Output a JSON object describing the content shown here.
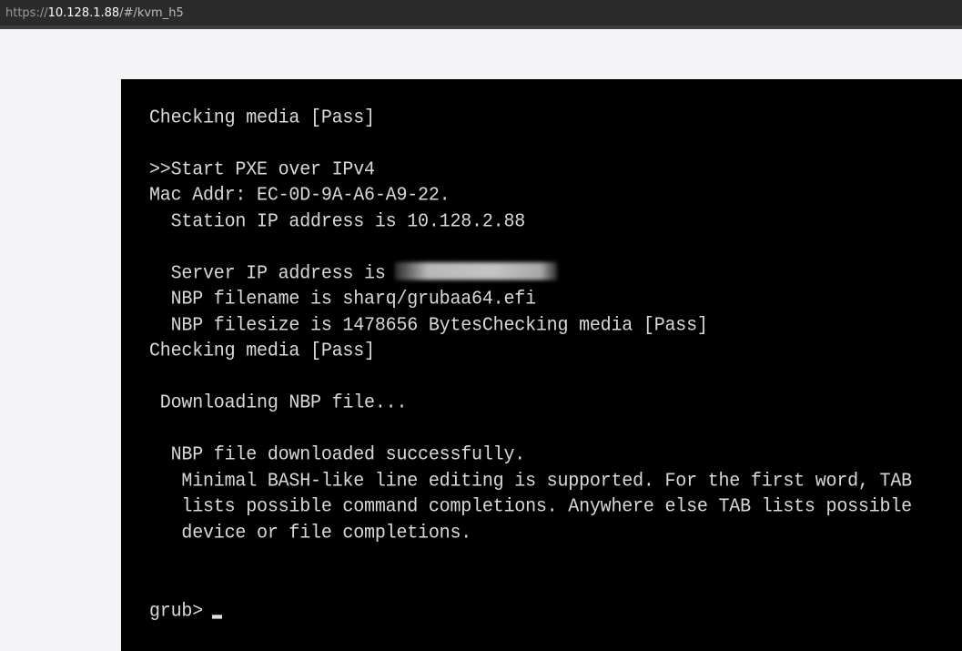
{
  "browser": {
    "url_scheme": "https://",
    "url_host": "10.128.1.88",
    "url_path": "/#/kvm_h5"
  },
  "console": {
    "lines": [
      "Checking media [Pass]",
      ">>Start PXE over IPv4",
      "Mac Addr: EC-0D-9A-A6-A9-22.",
      "  Station IP address is 10.128.2.88",
      "  Server IP address is",
      "  NBP filename is sharq/grubaa64.efi",
      "  NBP filesize is 1478656 BytesChecking media [Pass]",
      "Checking media [Pass]",
      " Downloading NBP file...",
      "  NBP file downloaded successfully.",
      "   Minimal BASH-like line editing is supported. For the first word, TAB",
      "   lists possible command completions. Anywhere else TAB lists possible",
      "   device or file completions.",
      "grub>"
    ]
  }
}
